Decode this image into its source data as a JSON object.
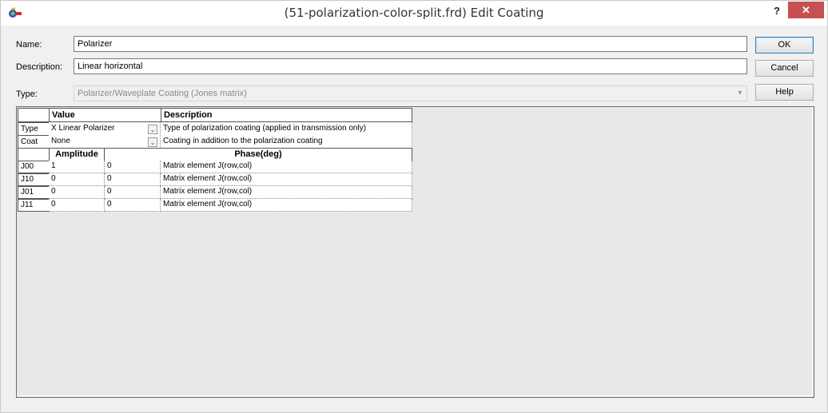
{
  "window": {
    "title": "(51-polarization-color-split.frd) Edit Coating",
    "help_glyph": "?",
    "close_glyph": "✕"
  },
  "form": {
    "name_label": "Name:",
    "name_value": "Polarizer",
    "description_label": "Description:",
    "description_value": "Linear horizontal",
    "type_label": "Type:",
    "type_value": "Polarizer/Waveplate Coating (Jones matrix)"
  },
  "buttons": {
    "ok": "OK",
    "cancel": "Cancel",
    "help": "Help"
  },
  "grid": {
    "headers": {
      "value": "Value",
      "description": "Description"
    },
    "rows": [
      {
        "key": "Type",
        "value": "X Linear Polarizer",
        "description": "Type of polarization coating (applied in transmission only)"
      },
      {
        "key": "Coat",
        "value": "None",
        "description": "Coating in addition to the polarization coating"
      }
    ],
    "matrix_headers": {
      "amplitude": "Amplitude",
      "phase": "Phase(deg)"
    },
    "matrix_rows": [
      {
        "key": "J00",
        "amplitude": "1",
        "phase": "0",
        "description": "Matrix element J(row,col)"
      },
      {
        "key": "J10",
        "amplitude": "0",
        "phase": "0",
        "description": "Matrix element J(row,col)"
      },
      {
        "key": "J01",
        "amplitude": "0",
        "phase": "0",
        "description": "Matrix element J(row,col)"
      },
      {
        "key": "J11",
        "amplitude": "0",
        "phase": "0",
        "description": "Matrix element J(row,col)"
      }
    ]
  },
  "icons": {
    "app": "app-icon",
    "dropdown": "chevron-down-icon"
  },
  "colors": {
    "close_bg": "#c75050",
    "titlebar_bg": "#ffffff",
    "dialog_bg": "#f0f0f0"
  }
}
